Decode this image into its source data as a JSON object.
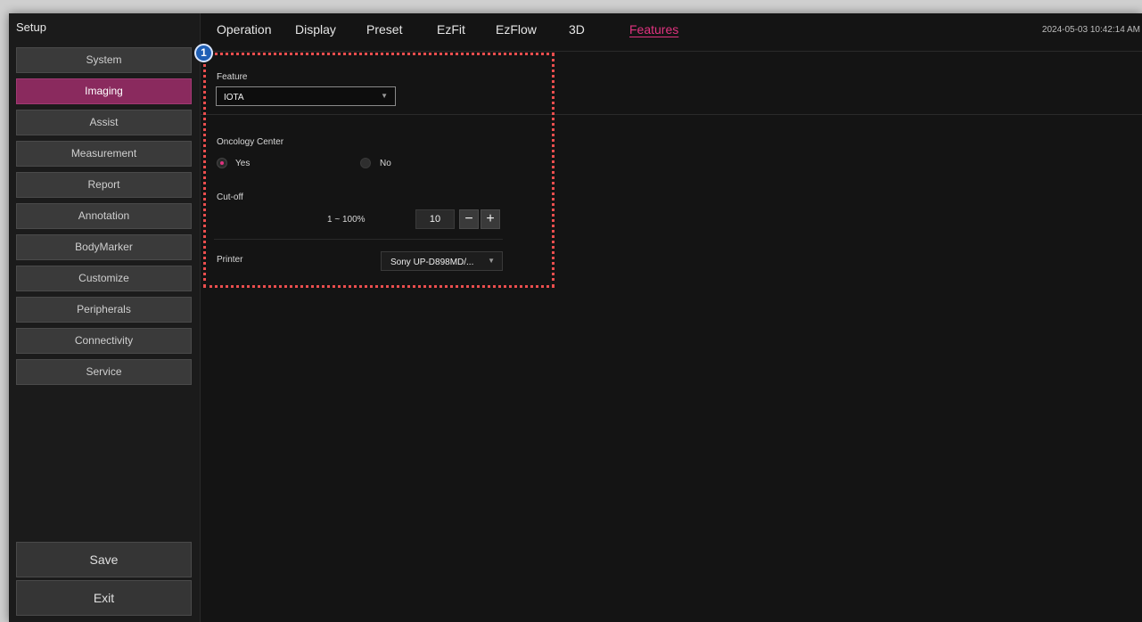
{
  "sidebar": {
    "title": "Setup",
    "items": [
      {
        "label": "System"
      },
      {
        "label": "Imaging"
      },
      {
        "label": "Assist"
      },
      {
        "label": "Measurement"
      },
      {
        "label": "Report"
      },
      {
        "label": "Annotation"
      },
      {
        "label": "BodyMarker"
      },
      {
        "label": "Customize"
      },
      {
        "label": "Peripherals"
      },
      {
        "label": "Connectivity"
      },
      {
        "label": "Service"
      }
    ],
    "active_item": "Imaging",
    "save_label": "Save",
    "exit_label": "Exit"
  },
  "tabs": [
    {
      "label": "Operation"
    },
    {
      "label": "Display"
    },
    {
      "label": "Preset"
    },
    {
      "label": "EzFit"
    },
    {
      "label": "EzFlow"
    },
    {
      "label": "3D"
    },
    {
      "label": "Features"
    }
  ],
  "active_tab": "Features",
  "datetime": "2024-05-03 10:42:14 AM",
  "feature": {
    "label": "Feature",
    "selected": "IOTA"
  },
  "oncology": {
    "label": "Oncology Center",
    "options": [
      {
        "label": "Yes",
        "selected": true
      },
      {
        "label": "No",
        "selected": false
      }
    ]
  },
  "cutoff": {
    "label": "Cut-off",
    "range": "1 ~ 100%",
    "value": "10",
    "minus": "−",
    "plus": "+"
  },
  "printer": {
    "label": "Printer",
    "selected": "Sony UP-D898MD/..."
  },
  "callout": {
    "number": "1",
    "color": "#1f5fb5"
  },
  "colors": {
    "accent": "#e0337f",
    "active_button": "#8a2a5e",
    "highlight_border": "#ea4e4e"
  }
}
